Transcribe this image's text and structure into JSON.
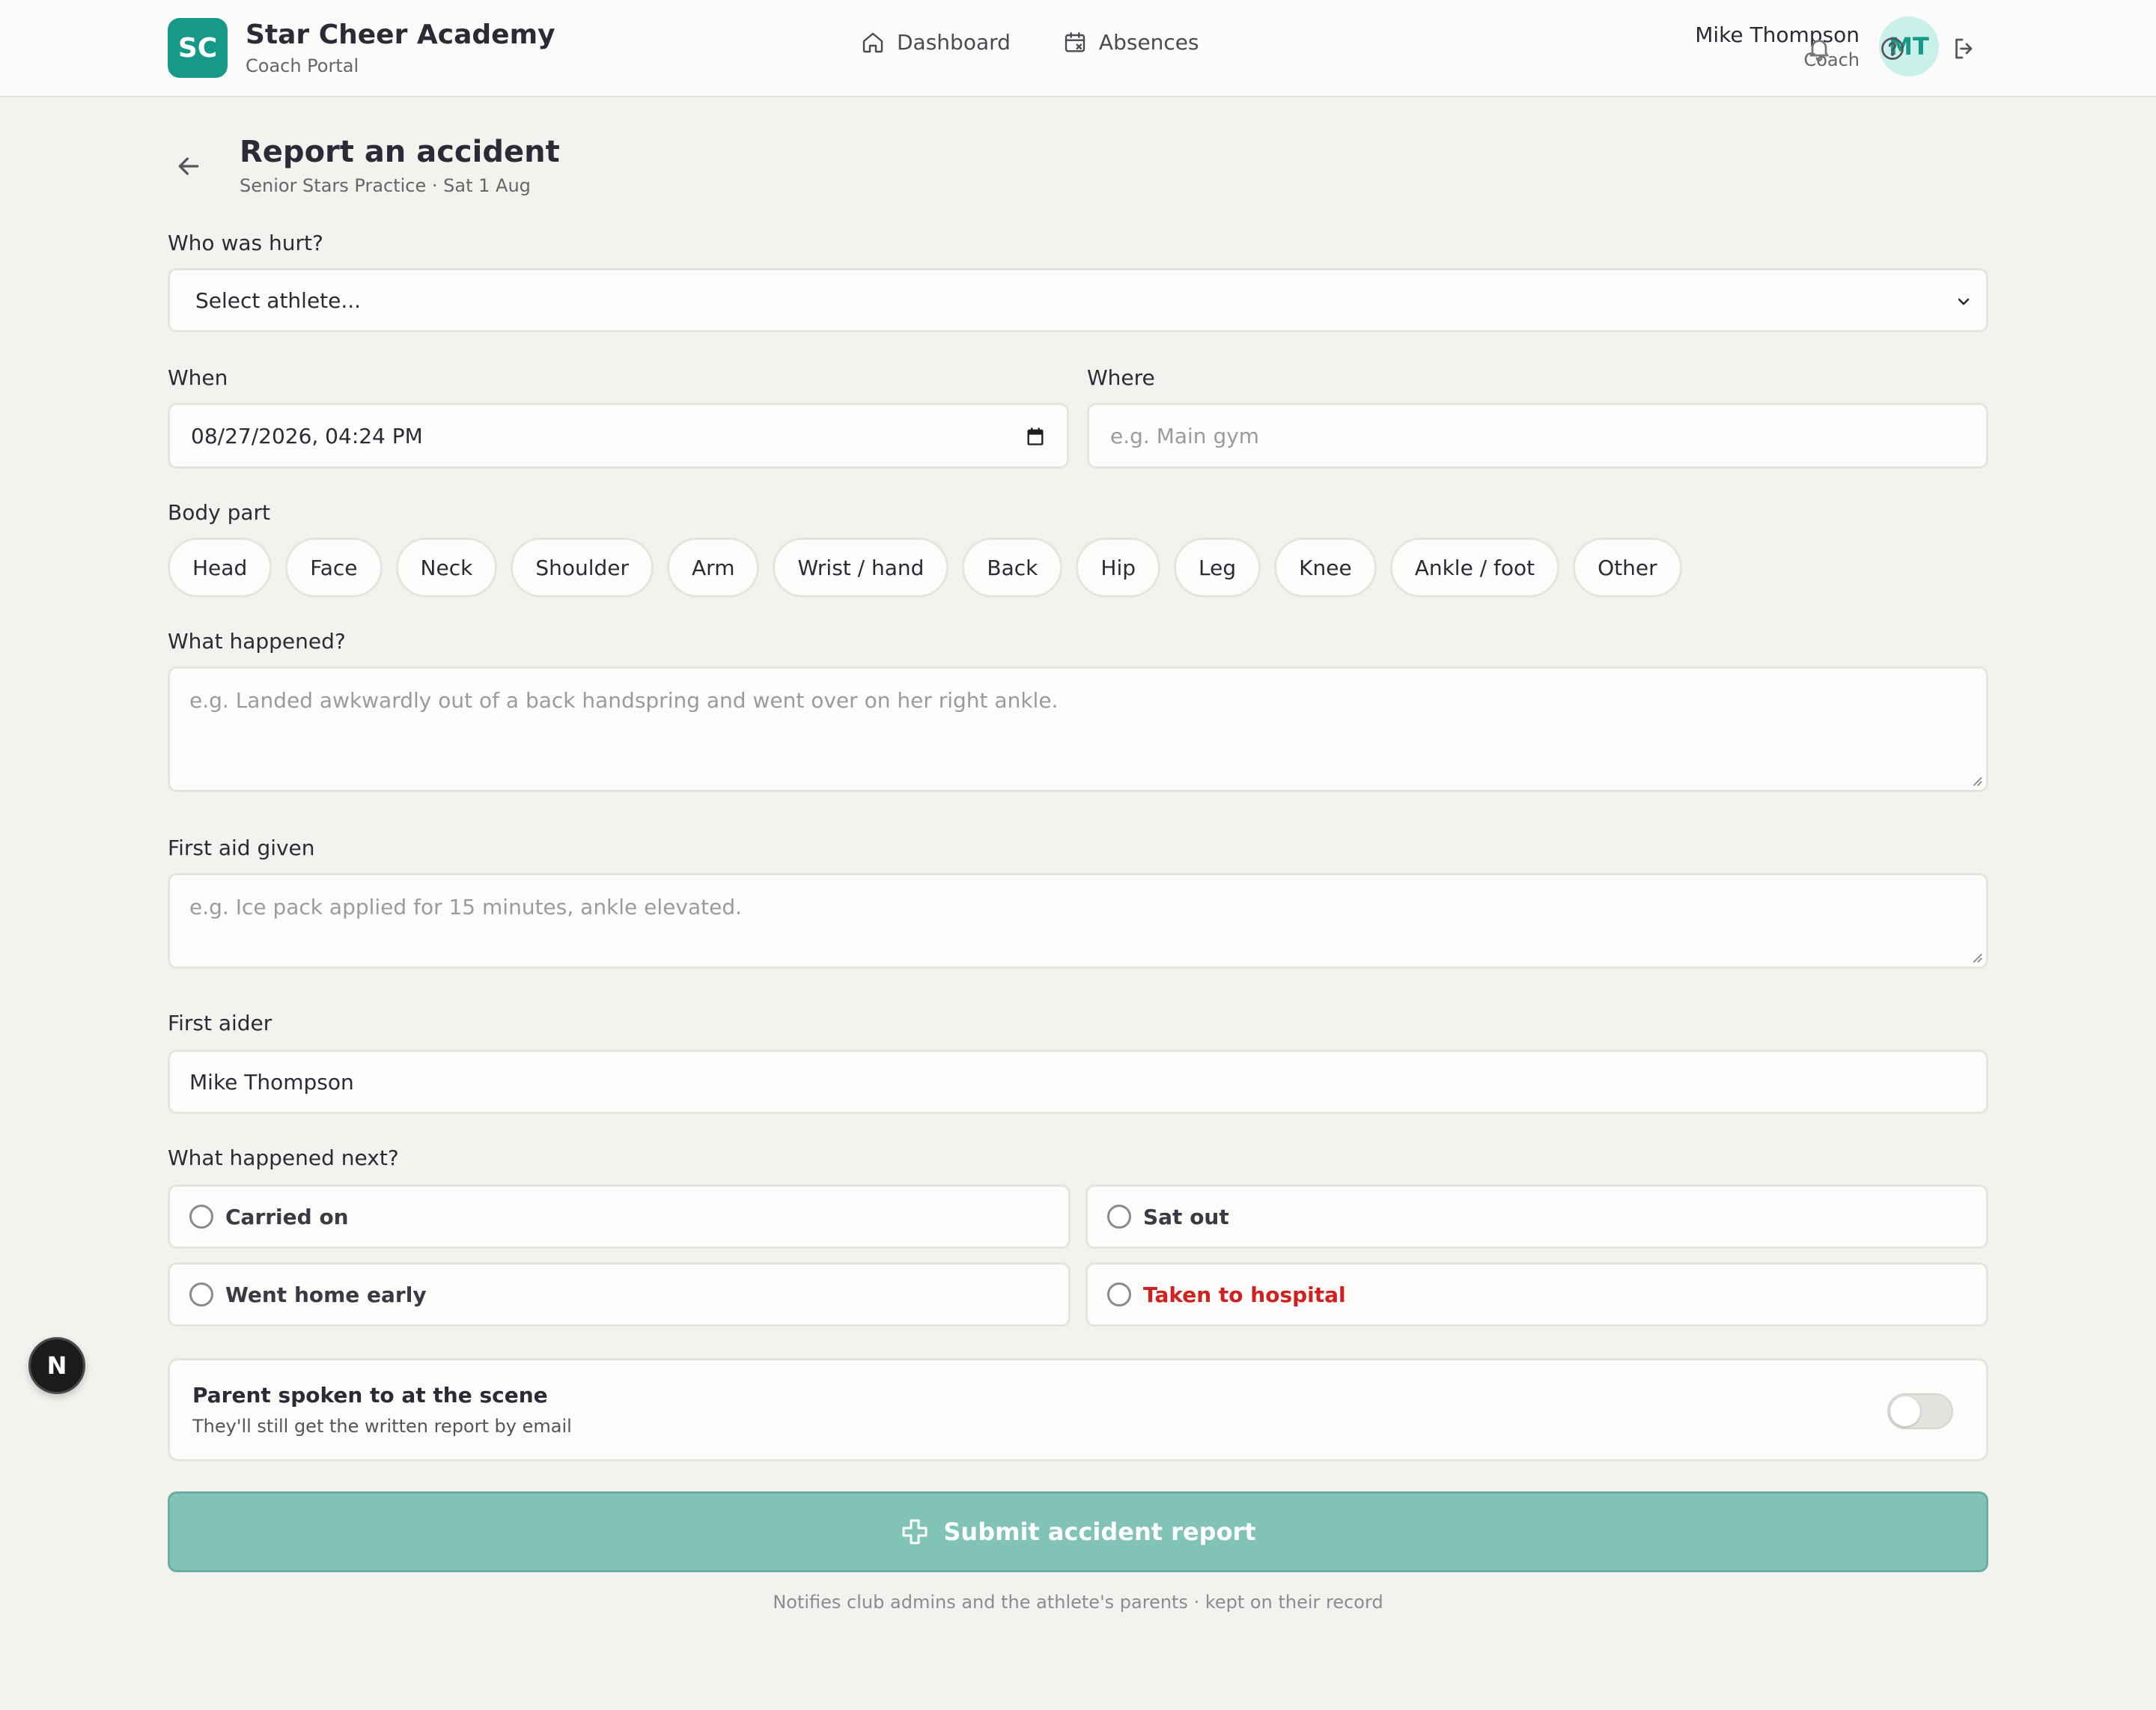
{
  "header": {
    "logo_initials": "SC",
    "brand_name": "Star Cheer Academy",
    "brand_sub": "Coach Portal",
    "nav": [
      {
        "label": "Dashboard",
        "icon": "home-icon"
      },
      {
        "label": "Absences",
        "icon": "calendar-x-icon"
      }
    ],
    "user_name": "Mike Thompson",
    "user_role": "Coach",
    "avatar_initials": "MT",
    "icons": [
      "bell-icon",
      "help-icon",
      "logout-icon"
    ]
  },
  "page": {
    "title": "Report an accident",
    "subtitle": "Senior Stars Practice · Sat 1 Aug"
  },
  "form": {
    "who_label": "Who was hurt?",
    "who_value": "Select athlete...",
    "when_label": "When",
    "when_value": "08/27/2026, 04:24 PM",
    "where_label": "Where",
    "where_placeholder": "e.g. Main gym",
    "body_part_label": "Body part",
    "body_parts": [
      "Head",
      "Face",
      "Neck",
      "Shoulder",
      "Arm",
      "Wrist / hand",
      "Back",
      "Hip",
      "Leg",
      "Knee",
      "Ankle / foot",
      "Other"
    ],
    "what_label": "What happened?",
    "what_placeholder": "e.g. Landed awkwardly out of a back handspring and went over on her right ankle.",
    "first_aid_label": "First aid given",
    "first_aid_placeholder": "e.g. Ice pack applied for 15 minutes, ankle elevated.",
    "first_aider_label": "First aider",
    "first_aider_value": "Mike Thompson",
    "next_label": "What happened next?",
    "next_options": [
      "Carried on",
      "Sat out",
      "Went home early",
      "Taken to hospital"
    ],
    "parent_title": "Parent spoken to at the scene",
    "parent_sub": "They'll still get the written report by email",
    "parent_toggle_on": false,
    "submit_label": "Submit accident report",
    "footnote": "Notifies club admins and the athlete's parents · kept on their record"
  },
  "colors": {
    "accent": "#17998a",
    "submit_disabled": "#82c3b8",
    "danger": "#d21f1f",
    "background": "#f4f2ef"
  },
  "floating_badge": "N"
}
